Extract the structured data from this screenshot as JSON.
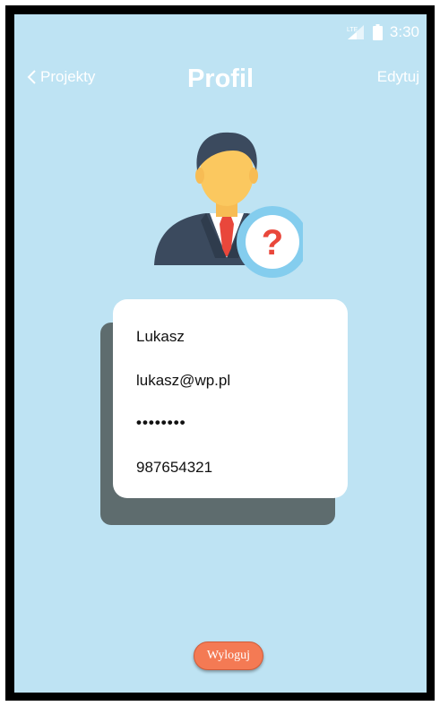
{
  "status_bar": {
    "time": "3:30",
    "icons": [
      "signal-icon",
      "battery-icon"
    ]
  },
  "nav": {
    "back_label": "Projekty",
    "back_icon": "chevron-left-icon",
    "title": "Profil",
    "edit_label": "Edytuj"
  },
  "avatar": {
    "icon": "user-question-icon",
    "badge_symbol": "?"
  },
  "profile": {
    "name": "Lukasz",
    "email": "lukasz@wp.pl",
    "password": "••••••••",
    "phone": "987654321"
  },
  "actions": {
    "logout_label": "Wyloguj"
  },
  "colors": {
    "background": "#bee3f3",
    "card": "#ffffff",
    "card_shadow": "#5e6c6e",
    "logout": "#f47a54",
    "badge_ring": "#84cdee",
    "badge_mark": "#e9473b"
  }
}
